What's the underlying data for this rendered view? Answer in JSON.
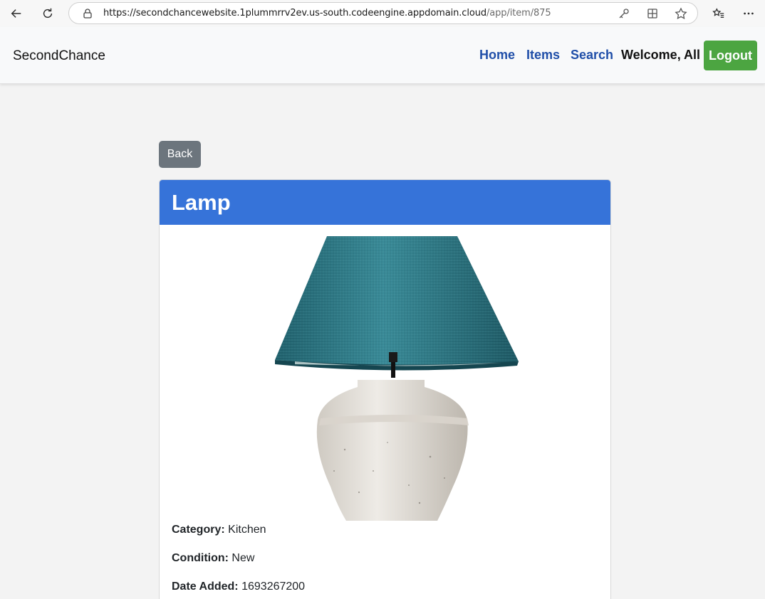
{
  "browser": {
    "url_host": "https://secondchancewebsite.1plummrrv2ev.us-south.codeengine.appdomain.cloud",
    "url_path": "/app/item/875"
  },
  "navbar": {
    "brand": "SecondChance",
    "links": [
      "Home",
      "Items",
      "Search"
    ],
    "welcome": "Welcome, All",
    "logout_label": "Logout"
  },
  "back_label": "Back",
  "item": {
    "name": "Lamp",
    "image_icon": "lamp-image",
    "details": [
      {
        "label": "Category:",
        "value": "Kitchen"
      },
      {
        "label": "Condition:",
        "value": "New"
      },
      {
        "label": "Date Added:",
        "value": "1693267200"
      }
    ]
  },
  "colors": {
    "header_blue": "#3673d9",
    "logout_green": "#4ca541",
    "back_gray": "#6c757d",
    "link_blue": "#1f4ea8"
  }
}
